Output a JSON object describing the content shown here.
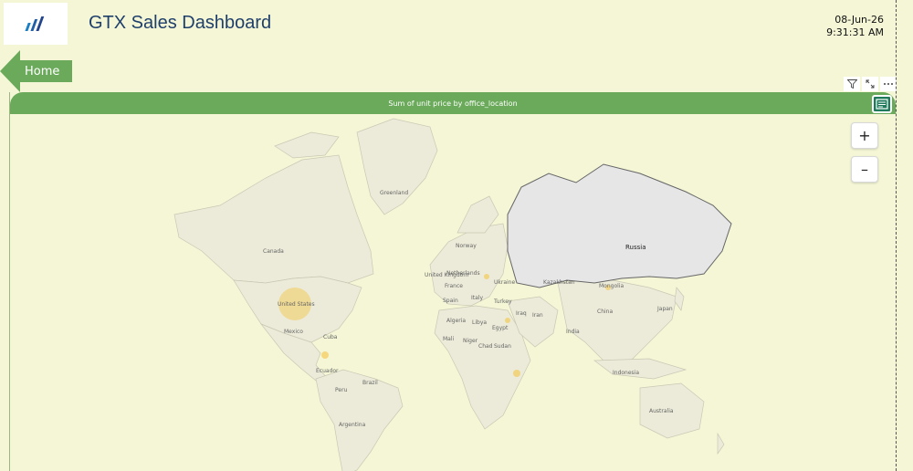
{
  "header": {
    "title": "GTX Sales Dashboard",
    "date": "08-Jun-26",
    "time": "9:31:31 AM",
    "logo_icon": "bar-chart-logo-icon"
  },
  "nav": {
    "home_label": "Home"
  },
  "visual": {
    "title": "Sum of unit price by office_location",
    "header_icons": [
      "filter-icon",
      "expand-icon",
      "more-options-icon"
    ],
    "focus_icon": "focus-mode-icon",
    "zoom_in": "+",
    "zoom_out": "–"
  },
  "map": {
    "labels": {
      "greenland": "Greenland",
      "canada": "Canada",
      "united_states": "United States",
      "mexico": "Mexico",
      "cuba": "Cuba",
      "ecuador": "Ecuador",
      "peru": "Peru",
      "brazil": "Brazil",
      "argentina": "Argentina",
      "norway": "Norway",
      "united_kingdom": "United Kingdom",
      "netherlands": "Netherlands",
      "france": "France",
      "spain": "Spain",
      "italy": "Italy",
      "ukraine": "Ukraine",
      "turkey": "Turkey",
      "algeria": "Algeria",
      "libya": "Libya",
      "egypt": "Egypt",
      "iraq": "Iraq",
      "iran": "Iran",
      "mali": "Mali",
      "niger": "Niger",
      "chad": "Chad",
      "sudan": "Sudan",
      "russia": "Russia",
      "kazakhstan": "Kazakhstan",
      "mongolia": "Mongolia",
      "china": "China",
      "japan": "Japan",
      "india": "India",
      "indonesia": "Indonesia",
      "australia": "Australia"
    },
    "highlighted_region": "Russia",
    "bubble_color": "#f5c542"
  }
}
